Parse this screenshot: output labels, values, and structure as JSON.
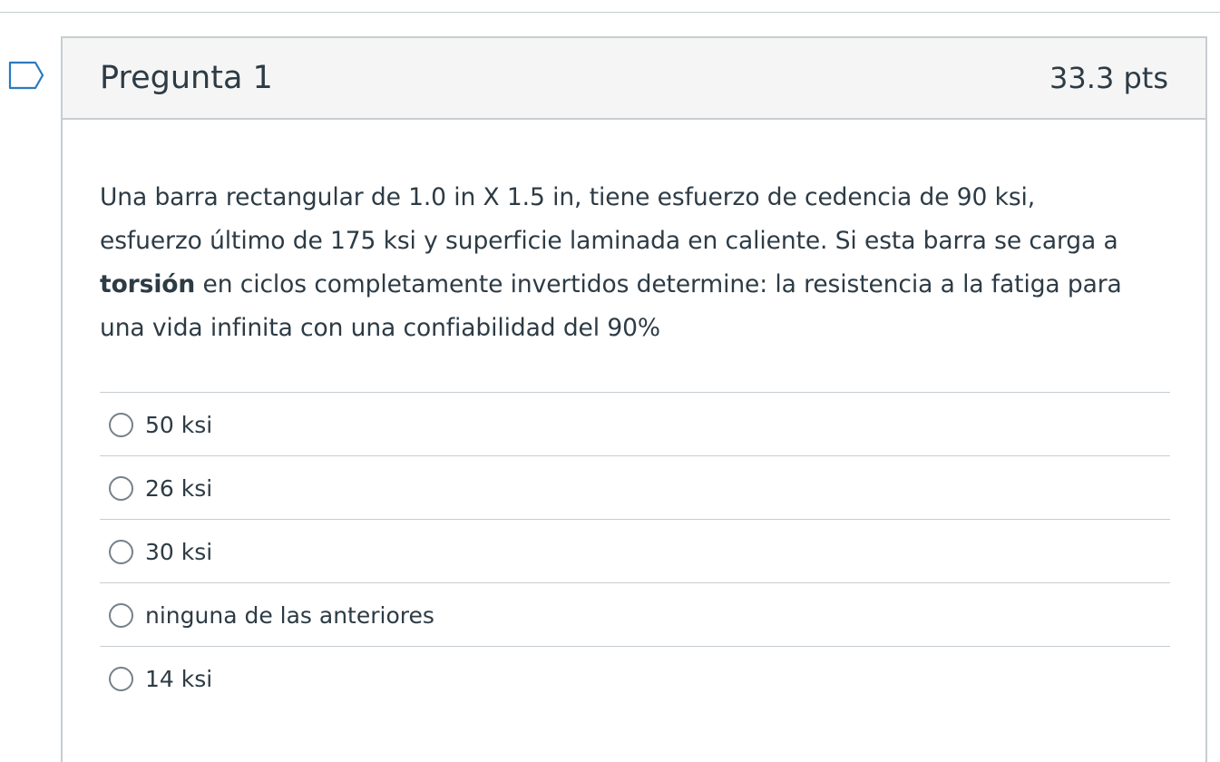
{
  "question": {
    "title": "Pregunta 1",
    "points": "33.3 pts",
    "text": {
      "line1": "Una barra rectangular de 1.0 in  X 1.5 in, tiene esfuerzo de cedencia de 90 ksi,",
      "line2": "esfuerzo último de 175 ksi y superficie laminada en caliente. Si esta barra se carga a",
      "line3_bold": "torsión",
      "line3_rest": " en ciclos completamente invertidos determine: la resistencia a la fatiga para",
      "line4": "una vida infinita con una confiabilidad del 90%"
    },
    "answers": [
      {
        "label": "50 ksi"
      },
      {
        "label": "26 ksi"
      },
      {
        "label": "30 ksi"
      },
      {
        "label": "ninguna de las anteriores"
      },
      {
        "label": "14 ksi"
      }
    ]
  },
  "icons": {
    "flag": "flag-outline-icon",
    "radio": "radio-unchecked-icon"
  },
  "colors": {
    "text": "#2d3b45",
    "border": "#c7cdd1",
    "header_bg": "#f5f5f5",
    "radio_border": "#73818c"
  }
}
